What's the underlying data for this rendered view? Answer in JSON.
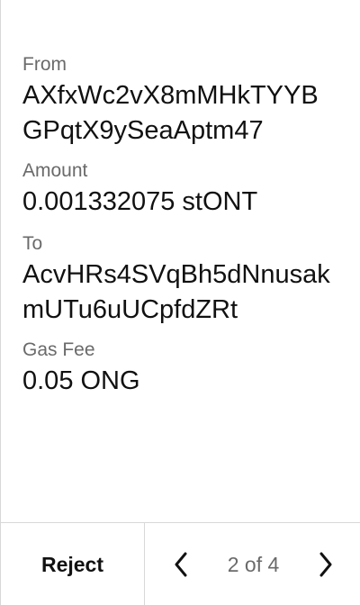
{
  "tx": {
    "from_label": "From",
    "from_value": "AXfxWc2vX8mMHkTYYBGPqtX9ySeaAptm47",
    "amount_label": "Amount",
    "amount_value": "0.001332075 stONT",
    "to_label": "To",
    "to_value": "AcvHRs4SVqBh5dNnusakmUTu6uUCpfdZRt",
    "fee_label": "Gas Fee",
    "fee_value": "0.05 ONG"
  },
  "footer": {
    "reject_label": "Reject",
    "page_indicator": "2 of 4",
    "prev_icon": "chevron-left-icon",
    "next_icon": "chevron-right-icon"
  }
}
